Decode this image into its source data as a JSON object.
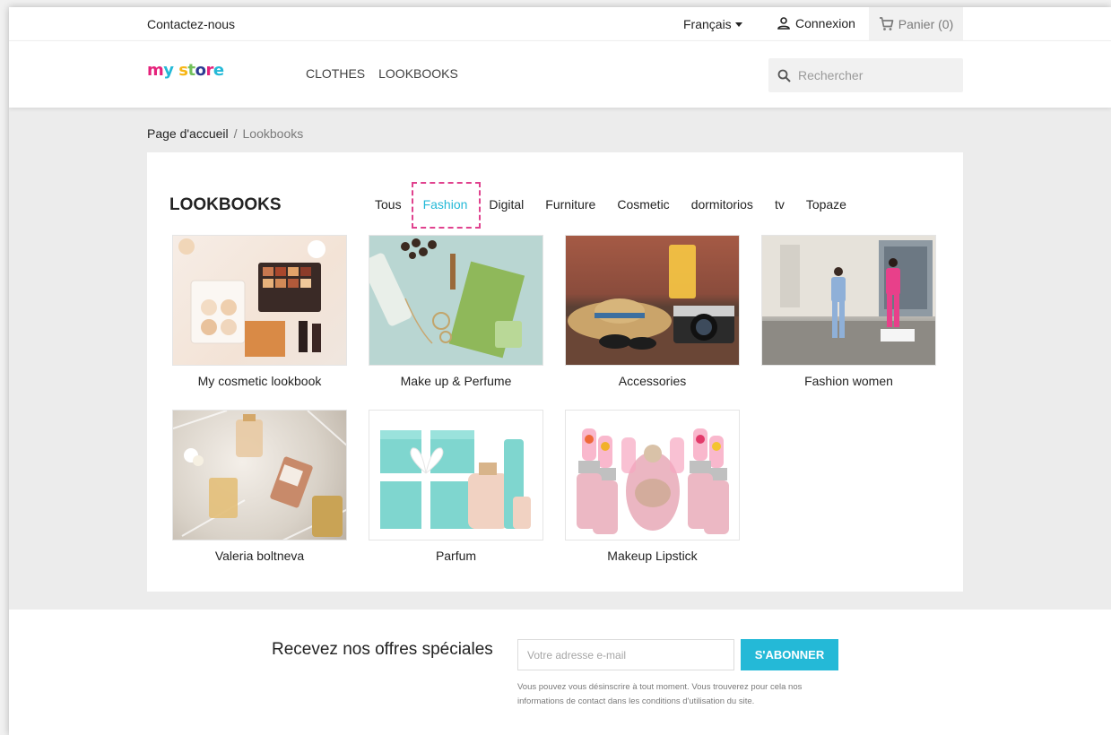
{
  "topbar": {
    "contact": "Contactez-nous",
    "language": "Français",
    "login": "Connexion",
    "cart": "Panier (0)"
  },
  "header": {
    "logo": {
      "part1": "my",
      "part2": "store",
      "colors": [
        "#e5227b",
        "#24b9d7",
        "#f7b617",
        "#72c05b",
        "#2d3a92"
      ]
    },
    "nav": [
      "CLOTHES",
      "LOOKBOOKS"
    ],
    "search_placeholder": "Rechercher"
  },
  "breadcrumb": {
    "home": "Page d'accueil",
    "separator": "/",
    "current": "Lookbooks"
  },
  "lookbooks": {
    "title": "LOOKBOOKS",
    "filters": [
      "Tous",
      "Fashion",
      "Digital",
      "Furniture",
      "Cosmetic",
      "dormitorios",
      "tv",
      "Topaze"
    ],
    "active_filter": "Fashion",
    "items": [
      {
        "label": "My cosmetic lookbook"
      },
      {
        "label": "Make up & Perfume"
      },
      {
        "label": "Accessories"
      },
      {
        "label": "Fashion women"
      },
      {
        "label": "Valeria boltneva"
      },
      {
        "label": "Parfum"
      },
      {
        "label": "Makeup Lipstick"
      }
    ]
  },
  "newsletter": {
    "title": "Recevez nos offres spéciales",
    "email_placeholder": "Votre adresse e-mail",
    "button": "S'ABONNER",
    "note": "Vous pouvez vous désinscrire à tout moment. Vous trouverez pour cela nos informations de contact dans les conditions d'utilisation du site."
  },
  "colors": {
    "accent": "#24b9d7",
    "highlight_box": "#e0428e"
  }
}
